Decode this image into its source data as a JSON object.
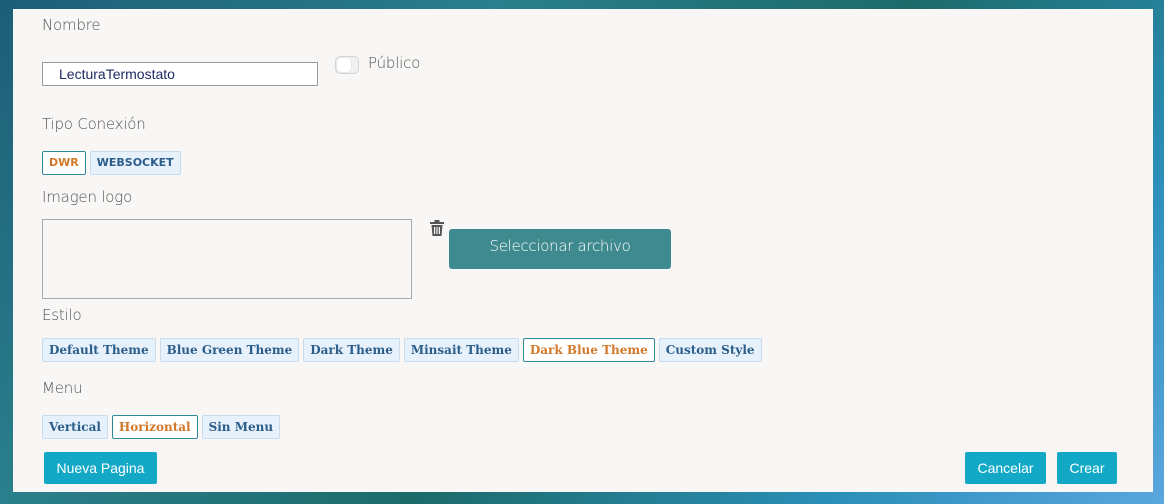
{
  "form": {
    "nombre_label": "Nombre",
    "nombre_value": "LecturaTermostato",
    "publico_label": "Público",
    "publico_checked": false,
    "tipo_conexion_label": "Tipo Conexión",
    "tipo_conexion_options": [
      "DWR",
      "WEBSOCKET"
    ],
    "tipo_conexion_selected": "DWR",
    "imagen_logo_label": "Imagen logo",
    "select_file_label": "Seleccionar archivo",
    "estilo_label": "Estilo",
    "estilo_options": [
      "Default Theme",
      "Blue Green Theme",
      "Dark Theme",
      "Minsait Theme",
      "Dark Blue Theme",
      "Custom Style"
    ],
    "estilo_selected": "Dark Blue Theme",
    "menu_label": "Menu",
    "menu_options": [
      "Vertical",
      "Horizontal",
      "Sin Menu"
    ],
    "menu_selected": "Horizontal"
  },
  "actions": {
    "nueva_pagina": "Nueva Pagina",
    "cancelar": "Cancelar",
    "crear": "Crear"
  },
  "icons": {
    "trash": "trash-icon"
  },
  "colors": {
    "primary_button": "#13a9c6",
    "file_button": "#3e8a8e",
    "chip_active_text": "#d2782a",
    "chip_text": "#2b5d8a"
  }
}
